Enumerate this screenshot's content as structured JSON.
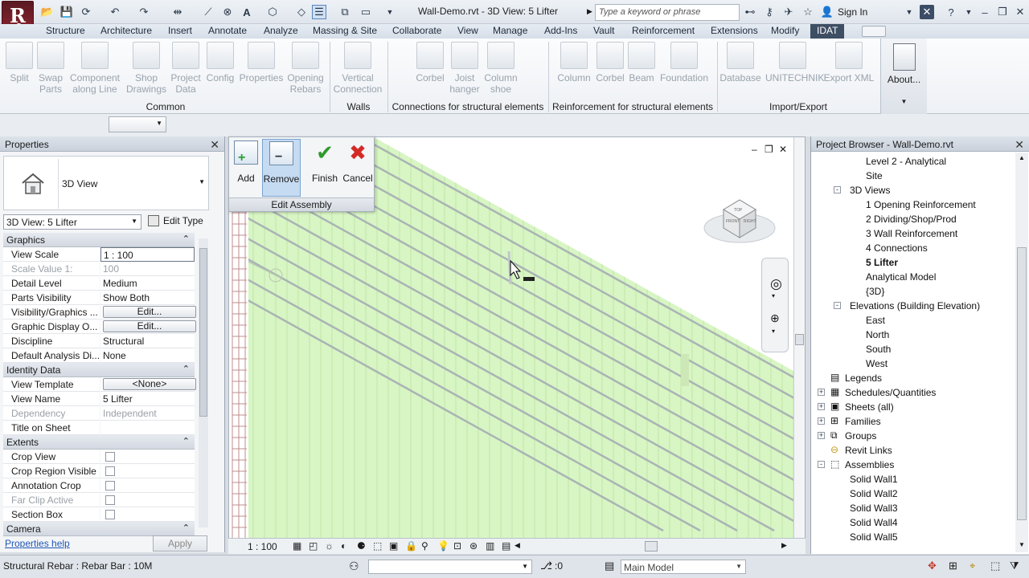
{
  "titlebar": {
    "document_title": "Wall-Demo.rvt - 3D View: 5 Lifter",
    "search_placeholder": "Type a keyword or phrase",
    "sign_in": "Sign In",
    "app_menu_letter": "R",
    "app_menu_sub": "S"
  },
  "tabs": [
    "Structure",
    "Architecture",
    "Insert",
    "Annotate",
    "Analyze",
    "Massing & Site",
    "Collaborate",
    "View",
    "Manage",
    "Add-Ins",
    "Vault",
    "Reinforcement",
    "Extensions",
    "Modify",
    "IDAT"
  ],
  "ribbon": {
    "common": {
      "panel": "Common",
      "buttons": [
        [
          "Split",
          ""
        ],
        [
          "Swap",
          "Parts"
        ],
        [
          "Component",
          "along Line"
        ],
        [
          "Shop",
          "Drawings"
        ],
        [
          "Project",
          "Data"
        ],
        [
          "Config",
          ""
        ],
        [
          "Properties",
          ""
        ],
        [
          "Opening",
          "Rebars"
        ]
      ]
    },
    "walls": {
      "panel": "Walls",
      "buttons": [
        [
          "Vertical",
          "Connection"
        ]
      ]
    },
    "connections": {
      "panel": "Connections for structural elements",
      "buttons": [
        [
          "Corbel",
          ""
        ],
        [
          "Joist",
          "hanger"
        ],
        [
          "Column",
          "shoe"
        ]
      ]
    },
    "reinforcement": {
      "panel": "Reinforcement for structural elements",
      "buttons": [
        [
          "Column",
          ""
        ],
        [
          "Corbel",
          ""
        ],
        [
          "Beam",
          ""
        ],
        [
          "Foundation",
          ""
        ]
      ]
    },
    "import_export": {
      "panel": "Import/Export",
      "buttons": [
        [
          "Database",
          ""
        ],
        [
          "UNITECHNIK",
          ""
        ],
        [
          "Export XML",
          ""
        ]
      ]
    },
    "about": "About..."
  },
  "edit_assembly": {
    "title": "Edit Assembly",
    "add": "Add",
    "remove": "Remove",
    "finish": "Finish",
    "cancel": "Cancel"
  },
  "properties": {
    "title": "Properties",
    "type_name": "3D View",
    "instance_selector": "3D View: 5 Lifter",
    "edit_type": "Edit Type",
    "sections": {
      "graphics": "Graphics",
      "identity": "Identity Data",
      "extents": "Extents",
      "camera": "Camera"
    },
    "graphics_rows": [
      {
        "k": "View Scale",
        "v": "1 : 100"
      },
      {
        "k": "Scale Value    1:",
        "v": "100"
      },
      {
        "k": "Detail Level",
        "v": "Medium"
      },
      {
        "k": "Parts Visibility",
        "v": "Show Both"
      },
      {
        "k": "Visibility/Graphics ...",
        "v": "Edit..."
      },
      {
        "k": "Graphic Display O...",
        "v": "Edit..."
      },
      {
        "k": "Discipline",
        "v": "Structural"
      },
      {
        "k": "Default Analysis Di...",
        "v": "None"
      }
    ],
    "identity_rows": [
      {
        "k": "View Template",
        "v": "<None>"
      },
      {
        "k": "View Name",
        "v": "5 Lifter"
      },
      {
        "k": "Dependency",
        "v": "Independent"
      },
      {
        "k": "Title on Sheet",
        "v": ""
      }
    ],
    "extents_rows": [
      {
        "k": "Crop View",
        "v": ""
      },
      {
        "k": "Crop Region Visible",
        "v": ""
      },
      {
        "k": "Annotation Crop",
        "v": ""
      },
      {
        "k": "Far Clip Active",
        "v": ""
      },
      {
        "k": "Section Box",
        "v": ""
      }
    ],
    "help_link": "Properties help",
    "apply": "Apply"
  },
  "view": {
    "scale_label": "1 : 100",
    "viewcube_faces": [
      "TOP",
      "FRONT",
      "RIGHT"
    ]
  },
  "browser": {
    "title": "Project Browser - Wall-Demo.rvt",
    "nodes": [
      {
        "label": "Level 2 - Analytical",
        "indent": 3,
        "toggle": ""
      },
      {
        "label": "Site",
        "indent": 3,
        "toggle": ""
      },
      {
        "label": "3D Views",
        "indent": 2,
        "toggle": "-"
      },
      {
        "label": "1 Opening Reinforcement",
        "indent": 3,
        "toggle": ""
      },
      {
        "label": "2 Dividing/Shop/Prod",
        "indent": 3,
        "toggle": ""
      },
      {
        "label": "3 Wall Reinforcement",
        "indent": 3,
        "toggle": ""
      },
      {
        "label": "4 Connections",
        "indent": 3,
        "toggle": ""
      },
      {
        "label": "5 Lifter",
        "indent": 3,
        "toggle": "",
        "bold": true
      },
      {
        "label": "Analytical Model",
        "indent": 3,
        "toggle": ""
      },
      {
        "label": "{3D}",
        "indent": 3,
        "toggle": ""
      },
      {
        "label": "Elevations (Building Elevation)",
        "indent": 2,
        "toggle": "-"
      },
      {
        "label": "East",
        "indent": 3,
        "toggle": ""
      },
      {
        "label": "North",
        "indent": 3,
        "toggle": ""
      },
      {
        "label": "South",
        "indent": 3,
        "toggle": ""
      },
      {
        "label": "West",
        "indent": 3,
        "toggle": ""
      },
      {
        "label": "Legends",
        "indent": 1,
        "toggle": "",
        "icon": "legend"
      },
      {
        "label": "Schedules/Quantities",
        "indent": 1,
        "toggle": "+",
        "icon": "schedule"
      },
      {
        "label": "Sheets (all)",
        "indent": 1,
        "toggle": "+",
        "icon": "sheet"
      },
      {
        "label": "Families",
        "indent": 1,
        "toggle": "+",
        "icon": "family"
      },
      {
        "label": "Groups",
        "indent": 1,
        "toggle": "+",
        "icon": "group"
      },
      {
        "label": "Revit Links",
        "indent": 1,
        "toggle": "",
        "icon": "link"
      },
      {
        "label": "Assemblies",
        "indent": 1,
        "toggle": "-",
        "icon": "assembly"
      },
      {
        "label": "Solid Wall1",
        "indent": 2,
        "toggle": ""
      },
      {
        "label": "Solid Wall2",
        "indent": 2,
        "toggle": ""
      },
      {
        "label": "Solid Wall3",
        "indent": 2,
        "toggle": ""
      },
      {
        "label": "Solid Wall4",
        "indent": 2,
        "toggle": ""
      },
      {
        "label": "Solid Wall5",
        "indent": 2,
        "toggle": ""
      }
    ]
  },
  "status": {
    "message": "Structural Rebar : Rebar Bar : 10M",
    "count": ":0",
    "model": "Main Model"
  },
  "colors": {
    "wall_fill": "#d8f5c4",
    "rebar_line": "#a9b4b4",
    "idat_tab": "#3e4e63",
    "active_tool": "#c5dbf2"
  }
}
